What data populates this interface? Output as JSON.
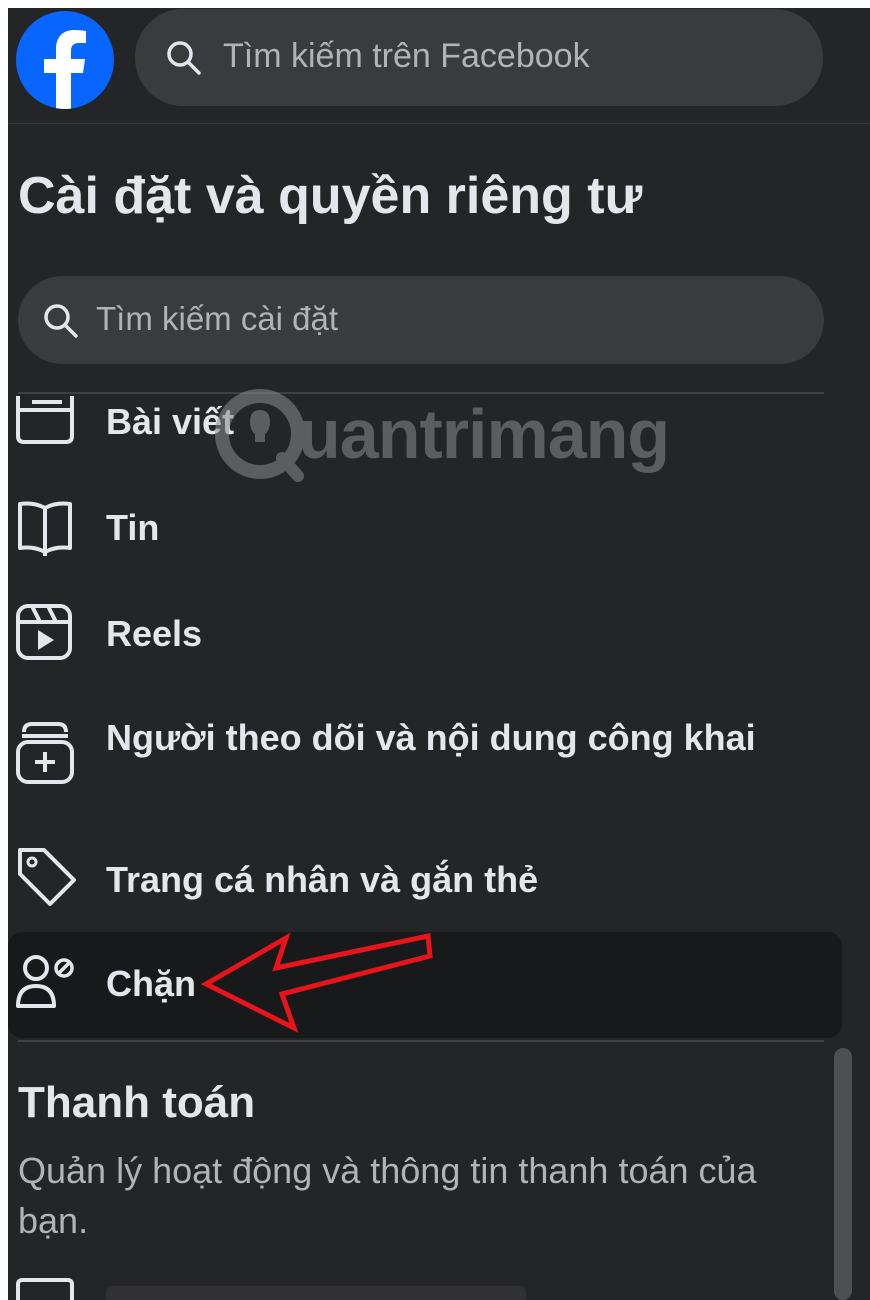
{
  "header": {
    "logo_icon": "facebook-logo-icon",
    "search_icon": "search-icon",
    "search_placeholder": "Tìm kiếm trên Facebook"
  },
  "page": {
    "title": "Cài đặt và quyền riêng tư",
    "search_placeholder": "Tìm kiếm cài đặt"
  },
  "menu": {
    "items": [
      {
        "label": "Bài viết",
        "icon": "posts-icon"
      },
      {
        "label": "Tin",
        "icon": "book-icon"
      },
      {
        "label": "Reels",
        "icon": "reels-icon"
      },
      {
        "label": "Người theo dõi và nội dung công khai",
        "icon": "followers-icon"
      },
      {
        "label": "Trang cá nhân và gắn thẻ",
        "icon": "tag-icon"
      },
      {
        "label": "Chặn",
        "icon": "block-user-icon"
      }
    ]
  },
  "payments": {
    "heading": "Thanh toán",
    "description": "Quản lý hoạt động và thông tin thanh toán của bạn."
  },
  "watermark": {
    "text": "uantrimang"
  },
  "colors": {
    "background": "#242526",
    "surface": "#3a3b3c",
    "highlight": "#18191a",
    "primary_text": "#e4e6eb",
    "secondary_text": "#b0b3b8",
    "facebook_blue": "#0866ff",
    "annotation_red": "#e8141a"
  }
}
